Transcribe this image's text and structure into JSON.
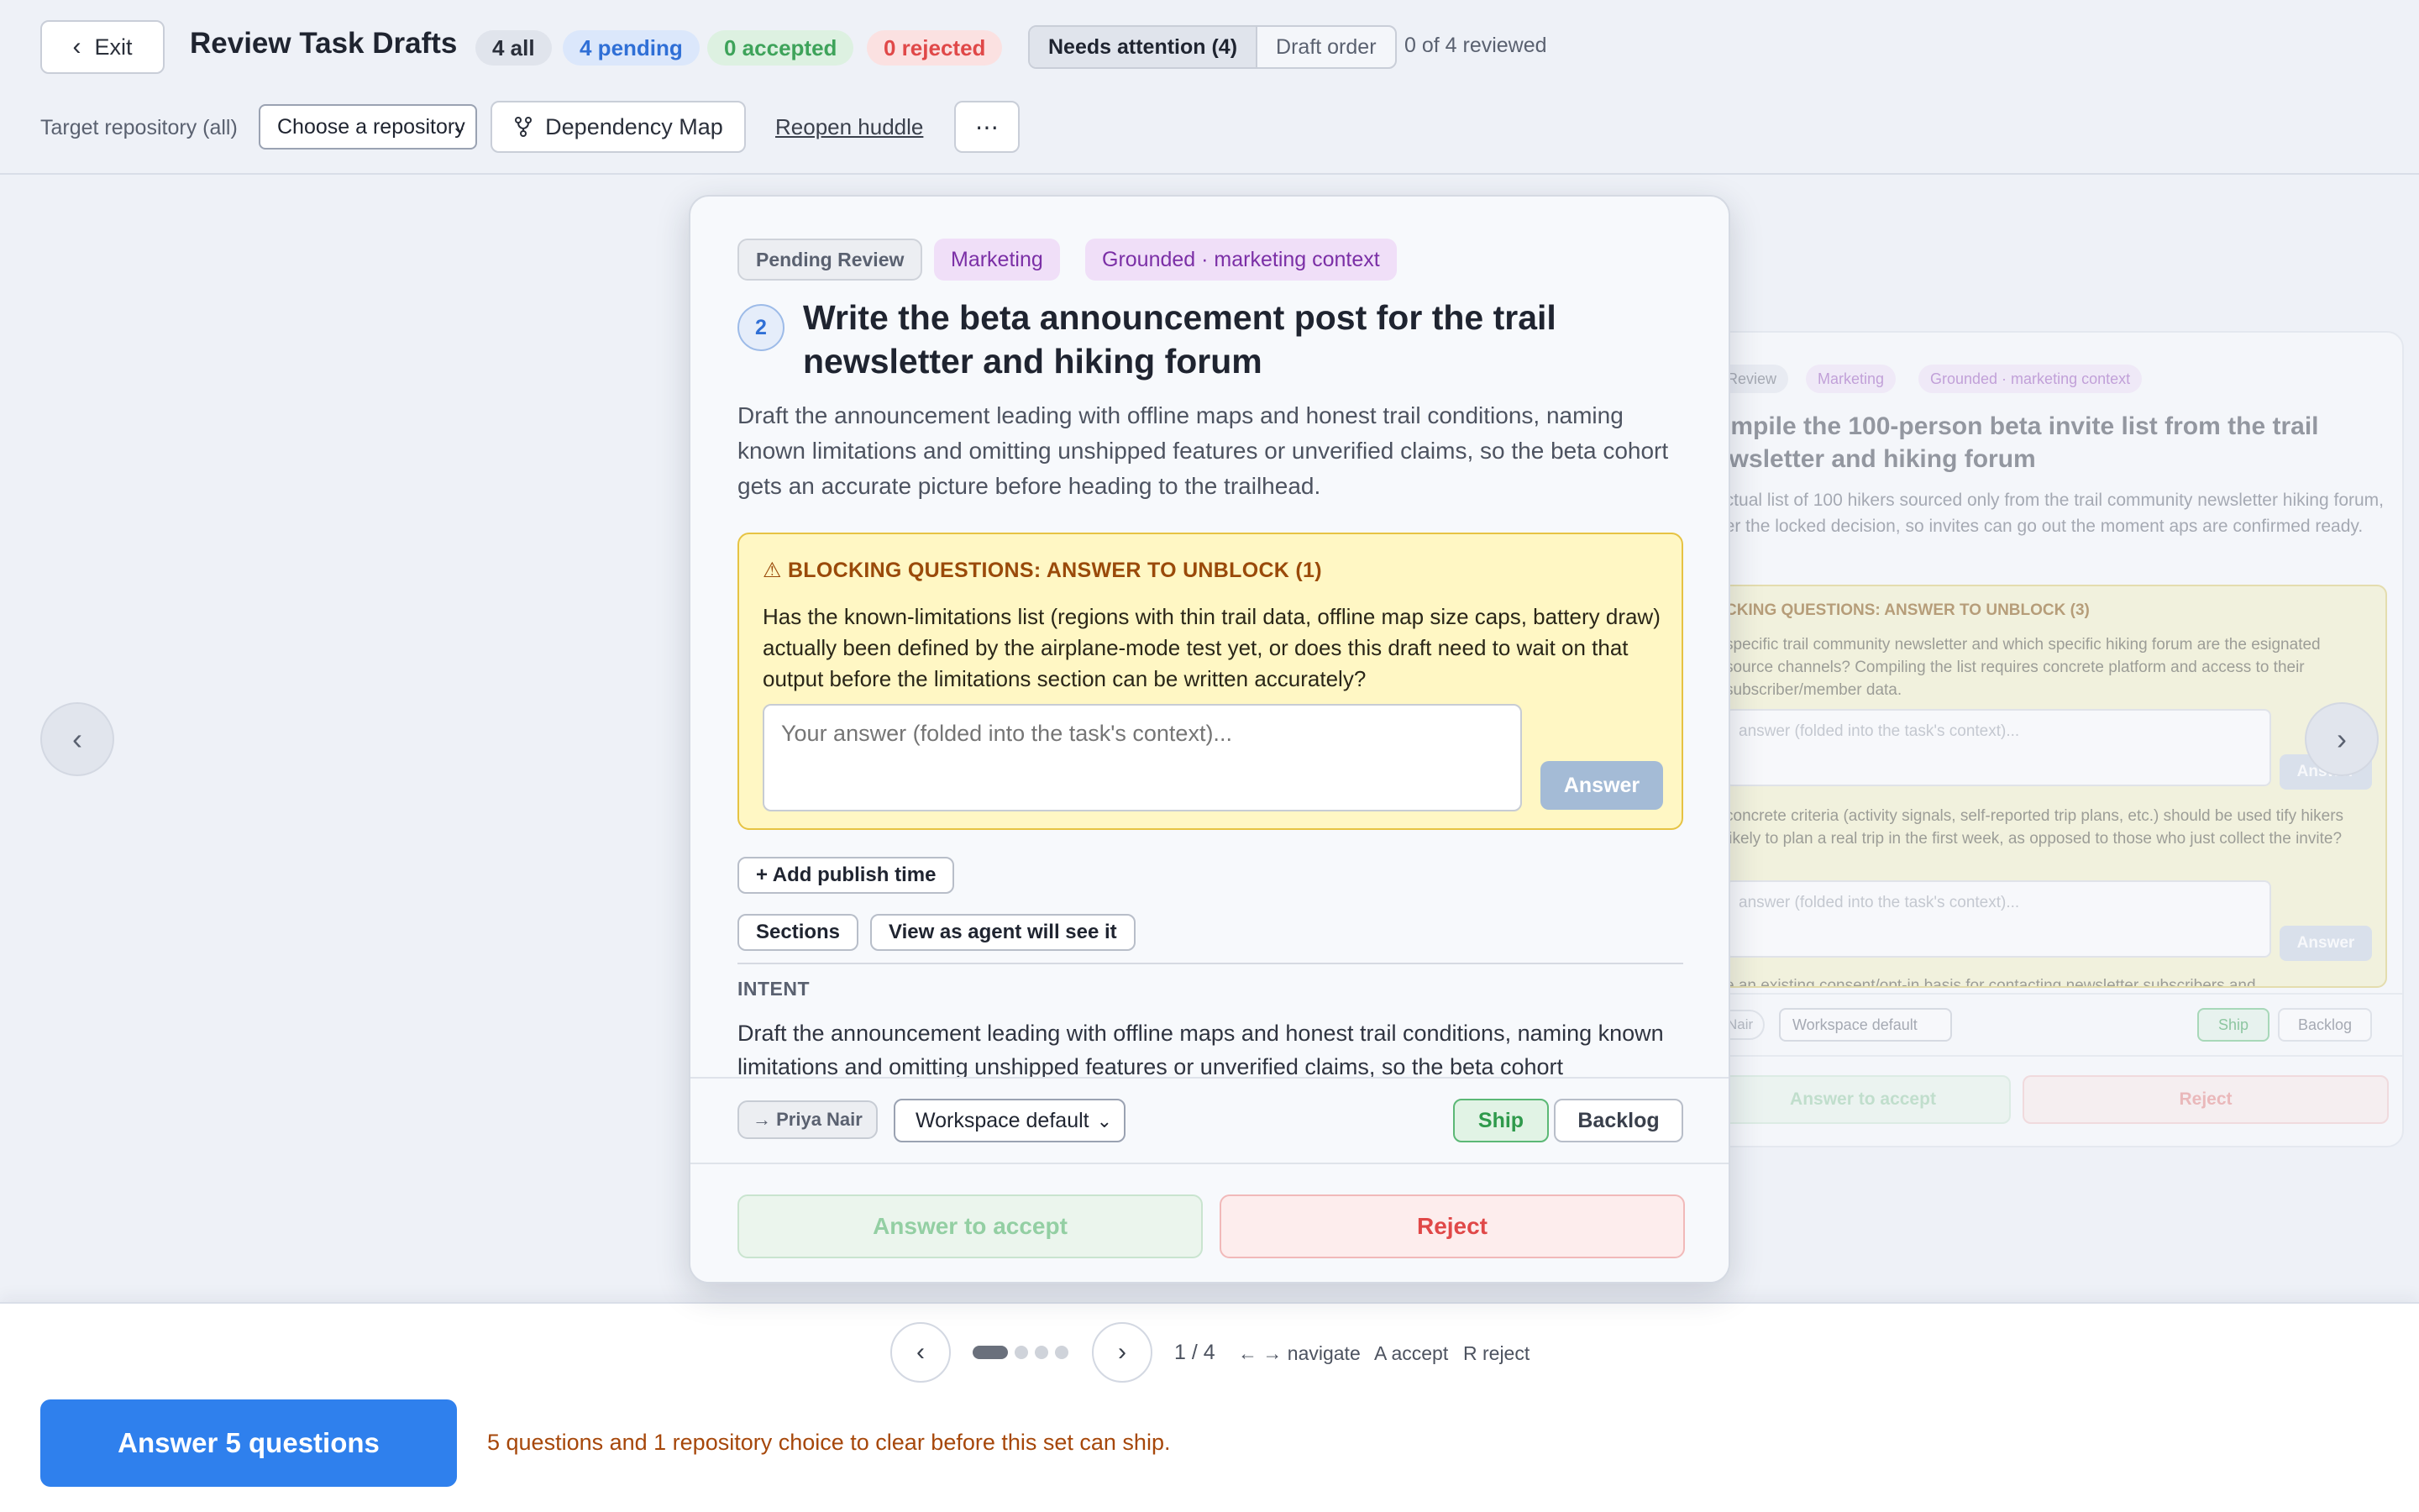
{
  "header": {
    "exit_label": "Exit",
    "title": "Review Task Drafts",
    "chips": {
      "all": "4 all",
      "pending": "4 pending",
      "accepted": "0 accepted",
      "rejected": "0 rejected"
    },
    "sort": {
      "active": "Needs attention (4)",
      "inactive": "Draft order"
    },
    "reviewed": "0 of 4 reviewed"
  },
  "toolbar": {
    "repo_label": "Target repository (all)",
    "repo_select": "Choose a repository",
    "dependency_map": "Dependency Map",
    "reopen_huddle": "Reopen huddle",
    "more": "⋯"
  },
  "card": {
    "status": "Pending Review",
    "category": "Marketing",
    "grounding": "Grounded · marketing context",
    "number": "2",
    "title": "Write the beta announcement post for the trail newsletter and hiking forum",
    "description": "Draft the announcement leading with offline maps and honest trail conditions, naming known limitations and omitting unshipped features or unverified claims, so the beta cohort gets an accurate picture before heading to the trailhead.",
    "blocking": {
      "title": "⚠ BLOCKING QUESTIONS: ANSWER TO UNBLOCK (1)",
      "question": "Has the known-limitations list (regions with thin trail data, offline map size caps, battery draw) actually been defined by the airplane-mode test yet, or does this draft need to wait on that output before the limitations section can be written accurately?",
      "placeholder": "Your answer (folded into the task's context)...",
      "answer_label": "Answer"
    },
    "add_publish": "+ Add publish time",
    "sections": "Sections",
    "view_agent": "View as agent will see it",
    "intent_label": "INTENT",
    "intent_text": "Draft the announcement leading with offline maps and honest trail conditions, naming known limitations and omitting unshipped features or unverified claims, so the beta cohort",
    "assignee": "→ Priya Nair",
    "workspace": "Workspace default",
    "ship": "Ship",
    "backlog": "Backlog",
    "accept": "Answer to accept",
    "reject": "Reject"
  },
  "next_card": {
    "status": "Review",
    "category": "Marketing",
    "grounding": "Grounded · marketing context",
    "title": "ompile the 100-person beta invite list from the trail ewsletter and hiking forum",
    "description": "actual list of 100 hikers sourced only from the trail community newsletter hiking forum, per the locked decision, so invites can go out the moment aps are confirmed ready.",
    "blocking_title": "CKING QUESTIONS: ANSWER TO UNBLOCK (3)",
    "q1": "specific trail community newsletter and which specific hiking forum are the esignated source channels? Compiling the list requires concrete platform and access to their subscriber/member data.",
    "q2": "concrete criteria (activity signals, self-reported trip plans, etc.) should be used tify hikers likely to plan a real trip in the first week, as opposed to those who just collect the invite?",
    "q3": "e an existing consent/opt-in basis for contacting newsletter subscribers and",
    "placeholder": "answer (folded into the task's context)...",
    "answer_label": "Answer",
    "assignee": "Nair",
    "workspace": "Workspace default",
    "ship": "Ship",
    "backlog": "Backlog",
    "accept": "Answer to accept",
    "reject": "Reject"
  },
  "pager": {
    "count": "1 / 4",
    "hint_nav": "← → navigate",
    "hint_accept": "A accept",
    "hint_reject": "R reject"
  },
  "footer": {
    "cta": "Answer 5 questions",
    "note": "5 questions and 1 repository choice to clear before this set can ship."
  },
  "icons": {
    "exit": "chevron-left-icon",
    "dependency": "branch-icon",
    "prev": "chevron-left-icon",
    "next": "chevron-right-icon"
  },
  "colors": {
    "accent": "#2f80ed",
    "pending": "#2f6fd6",
    "accepted": "#3ea35a",
    "rejected": "#e04848",
    "marketing": "#7b2fa6",
    "blocking_bg": "#fff7c4",
    "blocking_title": "#9a4a0a"
  }
}
